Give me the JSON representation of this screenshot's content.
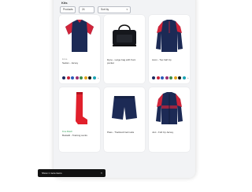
{
  "page": {
    "title": "Kits"
  },
  "filters": {
    "per_page": "24",
    "sort": "Sort by",
    "label_prefix": "Products"
  },
  "products": [
    {
      "brand": "Errea",
      "name": "Sedan - Jersey",
      "variant": "jersey",
      "swatches": [
        "#1a2a5e",
        "#c8233a",
        "#2a5cb8",
        "#9b2d6f",
        "#3b8f4a",
        "#e0a21c",
        "#111111",
        "#1aa3b5"
      ],
      "more": "+"
    },
    {
      "brand": "",
      "name": "Dyne - Large bag with front pocket",
      "variant": "bag",
      "swatches": [],
      "more": ""
    },
    {
      "brand": "",
      "name": "Avon - Top half zip",
      "variant": "jacket",
      "swatches": [
        "#1a2a5e",
        "#c8233a",
        "#2a5cb8",
        "#9b2d6f",
        "#3b8f4a",
        "#e0a21c",
        "#111111",
        "#1aa3b5"
      ],
      "more": "+"
    },
    {
      "brand": "Free Match",
      "name": "Bodadil - Training socks",
      "variant": "sock",
      "swatches": [],
      "more": ""
    },
    {
      "brand": "",
      "name": "Pass - Tracksuit bermuda",
      "variant": "shorts",
      "swatches": [],
      "more": ""
    },
    {
      "brand": "",
      "name": "Jovi - Full zip Jersey",
      "variant": "jacket2",
      "swatches": [
        "#1a2a5e",
        "#c8233a",
        "#2a5cb8",
        "#9b2d6f",
        "#3b8f4a",
        "#e0a21c",
        "#111111",
        "#1aa3b5"
      ],
      "more": "+"
    }
  ],
  "toast": {
    "message": "Show 1 more items",
    "close": "×"
  },
  "colors": {
    "navy": "#1c2a55",
    "red": "#d0243a",
    "panel_bg": "#f2f3f5"
  }
}
